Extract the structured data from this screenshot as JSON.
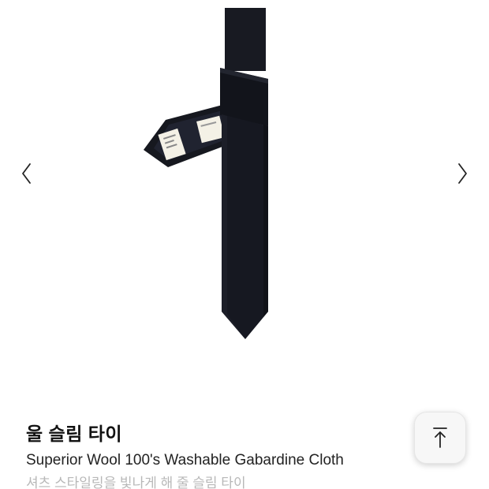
{
  "gallery": {
    "prev_icon": "chevron-left-icon",
    "next_icon": "chevron-right-icon",
    "image_subject": "navy-wool-slim-tie"
  },
  "product": {
    "title": "울 슬림 타이",
    "subtitle": "Superior Wool 100's Washable Gabardine Cloth",
    "description": "셔츠 스타일링을 빛나게 해 줄 슬림 타이"
  },
  "scroll_top": {
    "icon": "arrow-up-to-top-icon"
  },
  "colors": {
    "background": "#ffffff",
    "tie": "#14161f",
    "text_primary": "#111111",
    "text_muted": "#b8b8b8"
  }
}
